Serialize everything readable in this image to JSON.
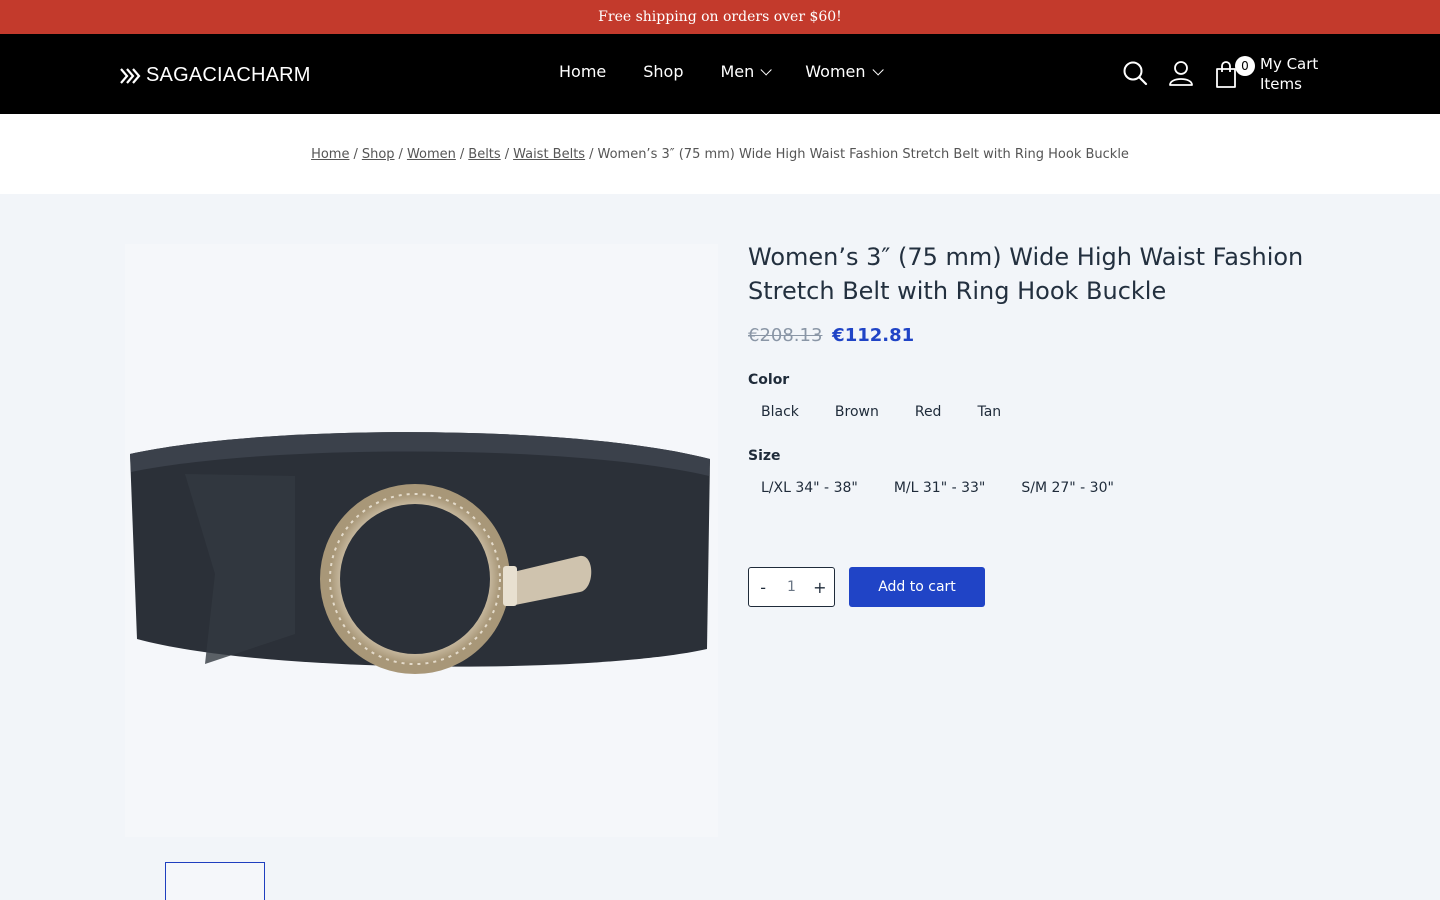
{
  "announcement": "Free shipping on orders over $60!",
  "header": {
    "logo_text": "SAGACIACHARM",
    "nav": [
      {
        "label": "Home",
        "has_dropdown": false
      },
      {
        "label": "Shop",
        "has_dropdown": false
      },
      {
        "label": "Men",
        "has_dropdown": true
      },
      {
        "label": "Women",
        "has_dropdown": true
      }
    ],
    "icons": [
      "search-icon",
      "account-icon",
      "shopping-bag-icon"
    ],
    "cart": {
      "count": "0",
      "label_line1": "My Cart",
      "label_line2": "Items"
    }
  },
  "breadcrumb": {
    "links": [
      "Home",
      "Shop",
      "Women",
      "Belts",
      "Waist Belts"
    ],
    "separator": "/",
    "current": "Women’s 3″ (75 mm) Wide High Waist Fashion Stretch Belt with Ring Hook Buckle"
  },
  "product": {
    "title": "Women’s 3″ (75 mm) Wide High Waist Fashion Stretch Belt with Ring Hook Buckle",
    "old_price": "€208.13",
    "price": "€112.81",
    "color_label": "Color",
    "colors": [
      "Black",
      "Brown",
      "Red",
      "Tan"
    ],
    "size_label": "Size",
    "sizes": [
      "L/XL 34\" - 38\"",
      "M/L 31\" - 33\"",
      "S/M 27\" - 30\""
    ],
    "quantity": {
      "minus": "-",
      "value": "1",
      "plus": "+"
    },
    "add_to_cart": "Add to cart"
  },
  "colors": {
    "announcement_bg": "#c33a2c",
    "header_bg": "#000000",
    "accent": "#2044c6",
    "page_bg": "#f2f5f9"
  }
}
